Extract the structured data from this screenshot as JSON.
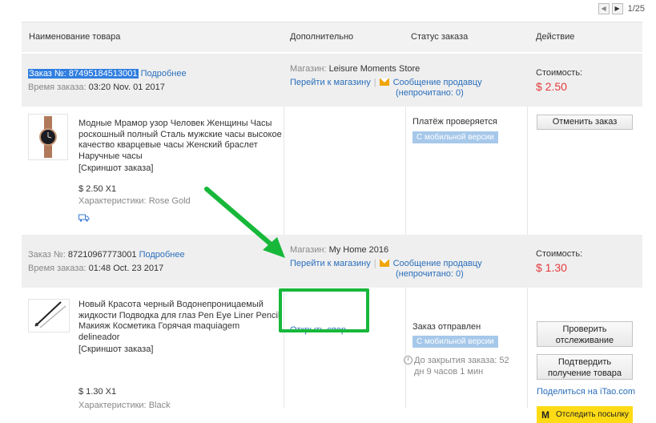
{
  "pager": {
    "count": "1/25"
  },
  "headers": {
    "product": "Наименование товара",
    "extra": "Дополнительно",
    "status": "Статус заказа",
    "action": "Действие"
  },
  "labels": {
    "order_no": "Заказ №:",
    "order_time": "Время заказа:",
    "details": "Подробнее",
    "store": "Магазин:",
    "goto_store": "Перейти к магазину",
    "sep": "|",
    "message_seller": "Сообщение продавцу",
    "cost": "Стоимость:",
    "screenshot": "[Скриншот заказа]",
    "characteristics": "Характеристики:",
    "mobile_version": "С мобильной версии"
  },
  "orders": [
    {
      "number": "87495184513001",
      "time": "03:20 Nov. 01 2017",
      "store": "Leisure Moments Store",
      "unread": "(непрочитано: 0)",
      "cost": "$ 2.50",
      "product_title_lines": [
        "Модные Мрамор узор Человек Женщины Часы",
        "роскошный полный Сталь мужские часы высокое",
        "качество кварцевые часы Женский браслет",
        "Наручные часы"
      ],
      "price_qty": "$ 2.50 X1",
      "characteristic": "Rose Gold",
      "status": "Платёж проверяется",
      "action_button": "Отменить заказ"
    },
    {
      "number": "87210967773001",
      "time": "01:48 Oct. 23 2017",
      "store": "My Home 2016",
      "unread": "(непрочитано: 0)",
      "cost": "$ 1.30",
      "product_title_lines": [
        "Новый Красота черный Водонепроницаемый",
        "жидкости Подводка для глаз Pen Eye Liner Pencil",
        "Макияж Косметика Горячая maquiagem",
        "delineador"
      ],
      "price_qty": "$ 1.30 X1",
      "characteristic": "Black",
      "dispute": "Открыть спор",
      "status": "Заказ отправлен",
      "countdown_lines": [
        "До закрытия заказа: 52",
        "дн 9 часов 1 мин"
      ],
      "btn_track_lines": [
        "Проверить",
        "отслеживание"
      ],
      "btn_confirm_lines": [
        "Подтвердить",
        "получение товара"
      ],
      "share_text": "Поделиться на iTao.com",
      "yellow_logo": "M",
      "yellow_text": "Отследить посылку"
    }
  ],
  "colors": {
    "accent_green": "#17b83a",
    "price_red": "#e4393c",
    "link_blue": "#2a6ebb"
  }
}
